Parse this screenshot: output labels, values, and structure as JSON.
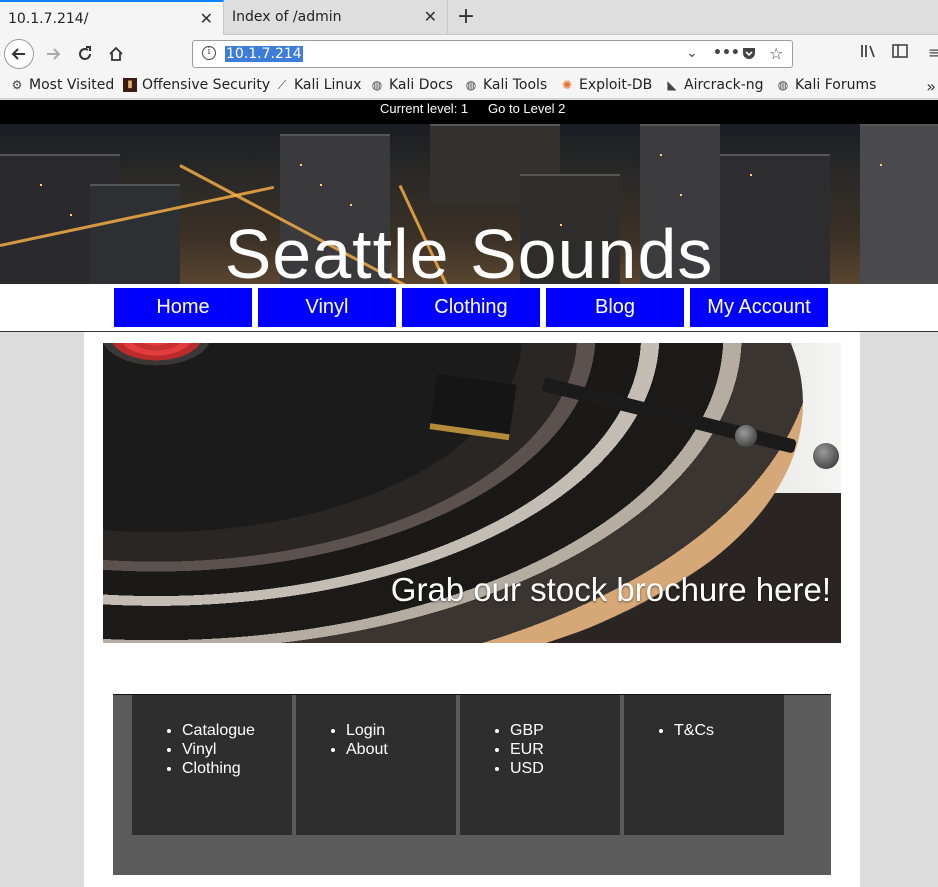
{
  "browser": {
    "tabs": [
      {
        "title": "10.1.7.214/",
        "active": true
      },
      {
        "title": "Index of /admin",
        "active": false
      }
    ],
    "url": "10.1.7.214",
    "bookmarks": [
      {
        "label": "Most Visited",
        "icon": "gear-icon"
      },
      {
        "label": "Offensive Security",
        "icon": "offsec-icon"
      },
      {
        "label": "Kali Linux",
        "icon": "kali-icon"
      },
      {
        "label": "Kali Docs",
        "icon": "globe-icon"
      },
      {
        "label": "Kali Tools",
        "icon": "globe-icon"
      },
      {
        "label": "Exploit-DB",
        "icon": "exploitdb-icon"
      },
      {
        "label": "Aircrack-ng",
        "icon": "aircrack-icon"
      },
      {
        "label": "Kali Forums",
        "icon": "globe-icon"
      }
    ]
  },
  "page": {
    "level_bar": {
      "current": "Current level: 1",
      "goto": "Go to Level 2"
    },
    "site_title": "Seattle Sounds",
    "nav": [
      "Home",
      "Vinyl",
      "Clothing",
      "Blog",
      "My Account"
    ],
    "banner_caption": "Grab our stock brochure here!",
    "footer_columns": [
      [
        "Catalogue",
        "Vinyl",
        "Clothing"
      ],
      [
        "Login",
        "About"
      ],
      [
        "GBP",
        "EUR",
        "USD"
      ],
      [
        "T&Cs"
      ]
    ],
    "colors": {
      "nav_bg": "#0000ff",
      "level_bar_bg": "#000000",
      "footer_bg": "#5b5b5b",
      "footer_col_bg": "#2e2e2e"
    }
  }
}
